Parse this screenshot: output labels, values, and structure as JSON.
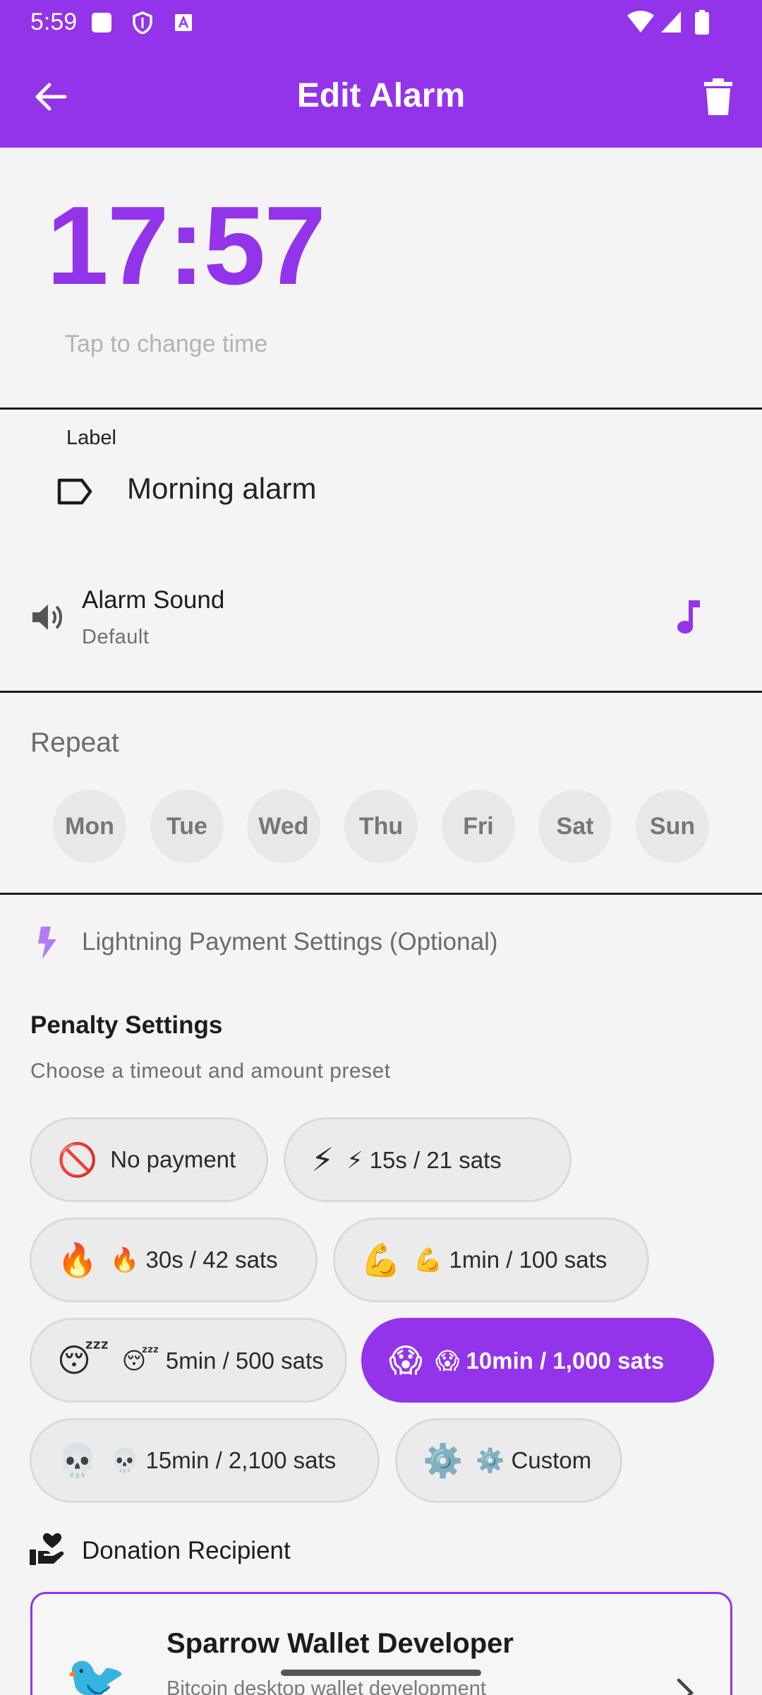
{
  "status_bar": {
    "time": "5:59"
  },
  "app_bar": {
    "title": "Edit Alarm",
    "back_icon": "arrow-back-icon",
    "delete_icon": "trash-icon"
  },
  "time": {
    "value": "17:57",
    "hint": "Tap to change time"
  },
  "label": {
    "caption": "Label",
    "value": "Morning alarm",
    "icon": "label-icon"
  },
  "sound": {
    "title": "Alarm Sound",
    "subtitle": "Default",
    "icon": "speaker-icon",
    "action_icon": "music-note-icon"
  },
  "repeat": {
    "title": "Repeat",
    "days": [
      "Mon",
      "Tue",
      "Wed",
      "Thu",
      "Fri",
      "Sat",
      "Sun"
    ]
  },
  "lightning": {
    "title": "Lightning Payment Settings (Optional)",
    "icon": "bolt-icon"
  },
  "penalty": {
    "title": "Penalty Settings",
    "subtitle": "Choose a timeout and amount preset",
    "presets": [
      {
        "emoji": "🚫",
        "label": "No payment",
        "selected": false
      },
      {
        "emoji": "⚡",
        "label": "⚡ 15s / 21 sats",
        "selected": false
      },
      {
        "emoji": "🔥",
        "label": "🔥 30s / 42 sats",
        "selected": false
      },
      {
        "emoji": "💪",
        "label": "💪 1min / 100 sats",
        "selected": false
      },
      {
        "emoji": "😴",
        "label": "😴 5min / 500 sats",
        "selected": false
      },
      {
        "emoji": "😱",
        "label": "😱 10min / 1,000 sats",
        "selected": true
      },
      {
        "emoji": "💀",
        "label": "💀 15min / 2,100 sats",
        "selected": false
      },
      {
        "emoji": "⚙️",
        "label": "⚙️ Custom",
        "selected": false
      }
    ]
  },
  "donation": {
    "title": "Donation Recipient",
    "icon": "donate-hand-heart-icon",
    "recipient": {
      "emoji": "🐦",
      "name": "Sparrow Wallet Developer",
      "description": "Bitcoin desktop wallet development"
    }
  },
  "colors": {
    "primary": "#9333ea",
    "background": "#f4f4f4",
    "chip": "#ebebeb"
  }
}
